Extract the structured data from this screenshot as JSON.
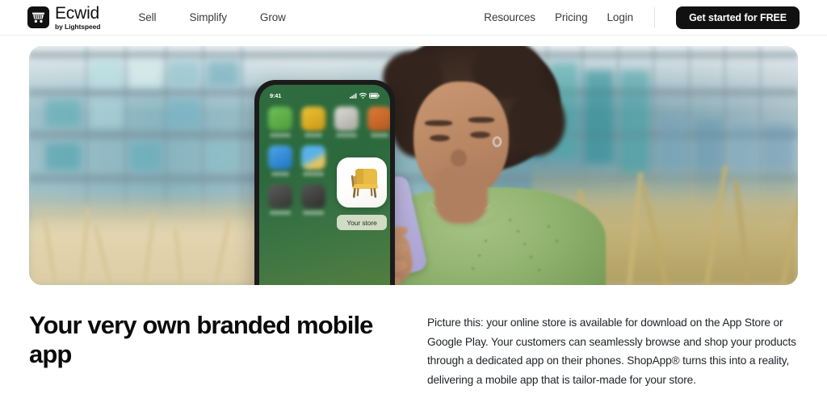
{
  "header": {
    "brand": {
      "name": "Ecwid",
      "tagline": "by Lightspeed",
      "logo_icon": "shopping-cart-icon",
      "logo_bg": "#111111"
    },
    "nav_left": [
      {
        "label": "Sell"
      },
      {
        "label": "Simplify"
      },
      {
        "label": "Grow"
      }
    ],
    "nav_right": [
      {
        "label": "Resources"
      },
      {
        "label": "Pricing"
      },
      {
        "label": "Login"
      }
    ],
    "cta": {
      "label": "Get started for FREE",
      "bg": "#111111",
      "color": "#ffffff"
    }
  },
  "hero": {
    "alt": "Woman in green sweater using a smartphone outdoors in front of a blurred glass office building with tall golden grass",
    "phone": {
      "status_time": "9:41",
      "status_icons": [
        "cellular-signal-icon",
        "wifi-icon",
        "battery-icon"
      ],
      "home_screen_color": "#2f6b3e",
      "store_app": {
        "label": "Your store",
        "icon": "armchair-icon",
        "icon_bg": "#ffffff",
        "chair_color": "#e3b23c"
      },
      "app_icons": [
        {
          "name": "app-icon-green",
          "color": "#5ba84a"
        },
        {
          "name": "app-icon-yellow",
          "color": "#d9a520"
        },
        {
          "name": "app-icon-grey",
          "color": "#b9b9b4"
        },
        {
          "name": "app-icon-orange",
          "color": "#c96a2a"
        },
        {
          "name": "app-icon-blue",
          "color": "#2f8fd8"
        },
        {
          "name": "app-icon-weather",
          "color": "#3f9de0"
        },
        {
          "name": "app-icon-dark",
          "color": "#4a4a4a"
        },
        {
          "name": "app-icon-dark-2",
          "color": "#3f3f3f"
        }
      ]
    },
    "person": {
      "sweater_color": "#93b572",
      "phone_color": "#bdb6e0"
    },
    "background": {
      "building_color": "#7fb0ba",
      "grass_color": "#cbbe96",
      "sky_color": "#ecf0f3"
    }
  },
  "content": {
    "headline": "Your very own branded mobile app",
    "paragraph": "Picture this: your online store is available for download on the App Store or Google Play. Your customers can seamlessly browse and shop your products through a dedicated app on their phones. ShopApp® turns this into a reality, delivering a mobile app that is tailor-made for your store."
  }
}
